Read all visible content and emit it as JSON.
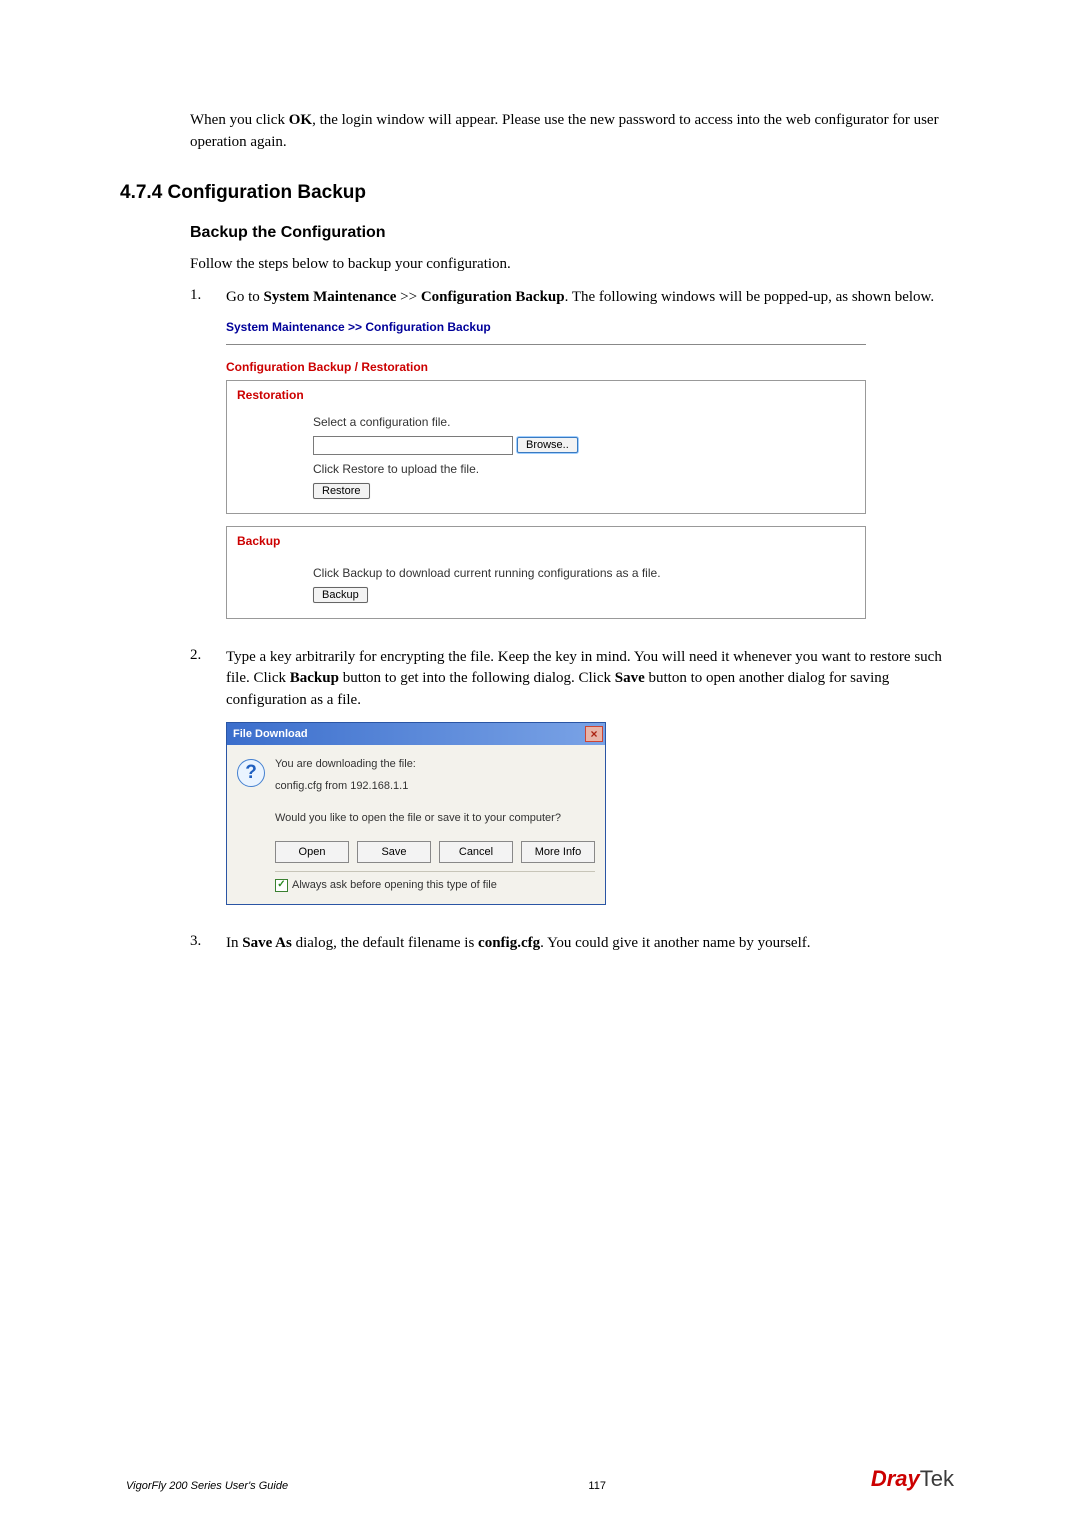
{
  "intro": {
    "prefix": "When you click ",
    "ok": "OK",
    "suffix": ", the login window will appear. Please use the new password to access into the web configurator for user operation again."
  },
  "headings": {
    "h2": "4.7.4 Configuration Backup",
    "h3": "Backup the Configuration"
  },
  "followText": "Follow the steps below to backup your configuration.",
  "step1": {
    "num": "1.",
    "t1": "Go to ",
    "b1": "System Maintenance",
    "t2": " >> ",
    "b2": "Configuration Backup",
    "t3": ". The following windows will be popped-up, as shown below."
  },
  "panel1": {
    "breadcrumb": "System Maintenance >> Configuration Backup",
    "title": "Configuration Backup / Restoration",
    "restoration": "Restoration",
    "selectFile": "Select a configuration file.",
    "browse": "Browse..",
    "restoreHint": "Click Restore to upload the file.",
    "restoreBtn": "Restore",
    "backup": "Backup",
    "backupHint": "Click Backup to download current running configurations as a file.",
    "backupBtn": "Backup"
  },
  "step2": {
    "num": "2.",
    "t1": "Type a key arbitrarily for encrypting the file. Keep the key in mind. You will need it whenever you want to restore such file. Click ",
    "b1": "Backup",
    "t2": " button to get into the following dialog. Click ",
    "b2": "Save",
    "t3": " button to open another dialog for saving configuration as a file."
  },
  "dialog": {
    "title": "File Download",
    "line1": "You are downloading the file:",
    "line2": "config.cfg from 192.168.1.1",
    "question": "Would you like to open the file or save it to your computer?",
    "open": "Open",
    "save": "Save",
    "cancel": "Cancel",
    "moreInfo": "More Info",
    "checkboxLabel": "Always ask before opening this type of file"
  },
  "step3": {
    "num": "3.",
    "t1": "In ",
    "b1": "Save As",
    "t2": " dialog, the default filename is ",
    "b2": "config.cfg",
    "t3": ". You could give it another name by yourself."
  },
  "footer": {
    "left": "VigorFly 200 Series User's Guide",
    "pageNum": "117",
    "brandDray": "Dray",
    "brandTek": "Tek"
  }
}
